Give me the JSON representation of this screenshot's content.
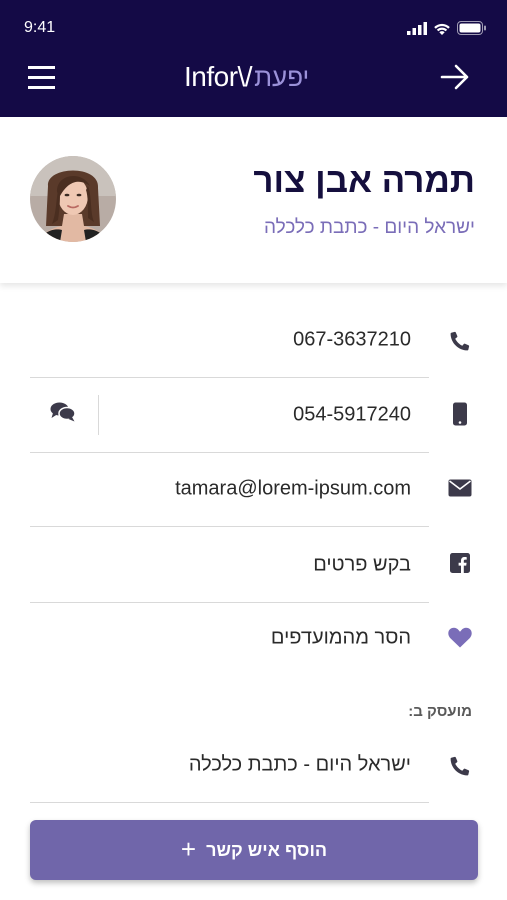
{
  "status_bar": {
    "time": "9:41"
  },
  "header": {
    "logo_en": "Infor\\/",
    "logo_he": "יפעת"
  },
  "profile": {
    "name": "תמרה אבן צור",
    "company": "ישראל היום - כתבת כלכלה"
  },
  "contact": {
    "phone": "067-3637210",
    "mobile": "054-5917240",
    "email": "tamara@lorem-ipsum.com",
    "facebook": "בקש פרטים",
    "favorite": "הסר מהמועדפים"
  },
  "employment": {
    "label": "מועסק ב:",
    "employer": "ישראל היום - כתבת כלכלה"
  },
  "actions": {
    "add_contact": "הוסף איש קשר"
  },
  "colors": {
    "header_bg": "#140a46",
    "accent": "#7066aa",
    "icon": "#3c3a4a"
  }
}
